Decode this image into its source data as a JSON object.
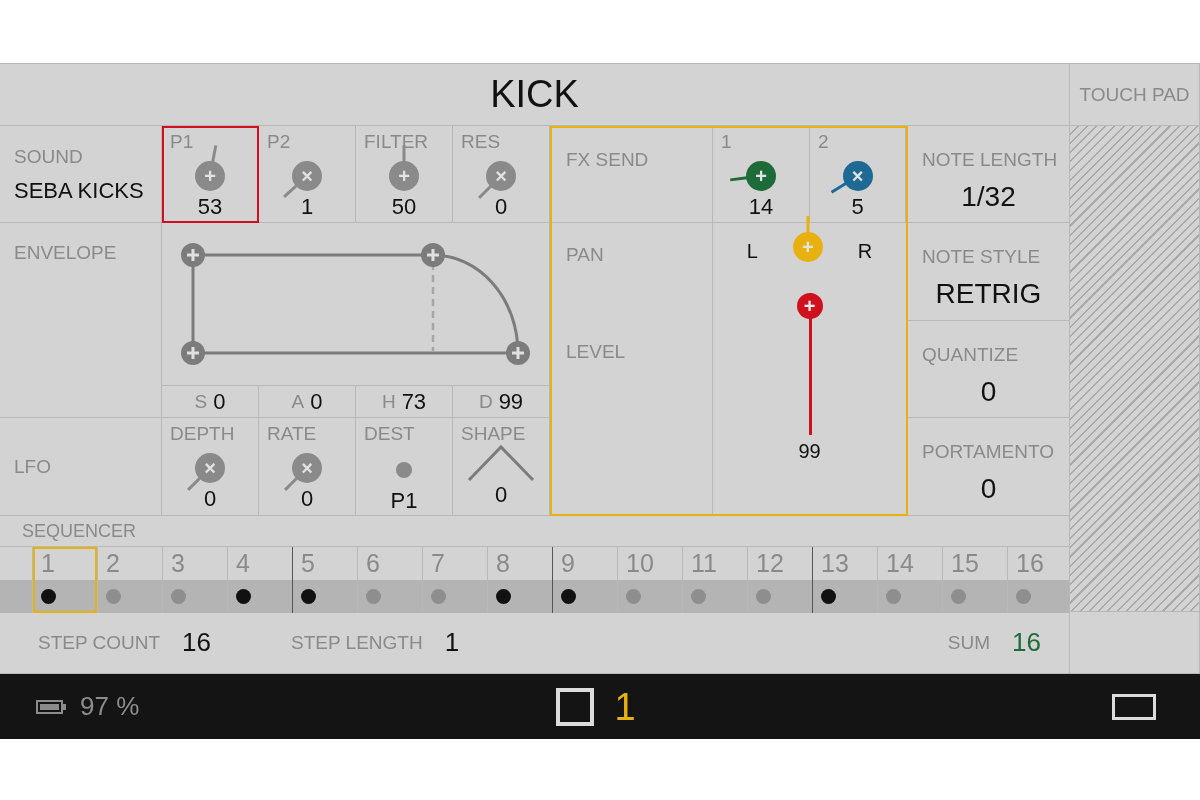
{
  "title": "KICK",
  "touch_pad": {
    "label": "TOUCH PAD"
  },
  "sound": {
    "label": "SOUND",
    "value": "SEBA KICKS"
  },
  "params": [
    {
      "label": "P1",
      "symbol": "+",
      "value": "53",
      "level": 0.54,
      "selected": true
    },
    {
      "label": "P2",
      "symbol": "×",
      "value": "1",
      "level": 0.01,
      "selected": false
    },
    {
      "label": "FILTER",
      "symbol": "+",
      "value": "50",
      "level": 0.5,
      "selected": false
    },
    {
      "label": "RES",
      "symbol": "×",
      "value": "0",
      "level": 0,
      "selected": false
    }
  ],
  "envelope": {
    "label": "ENVELOPE",
    "stages": [
      {
        "letter": "S",
        "value": "0"
      },
      {
        "letter": "A",
        "value": "0"
      },
      {
        "letter": "H",
        "value": "73"
      },
      {
        "letter": "D",
        "value": "99"
      }
    ]
  },
  "lfo": {
    "label": "LFO",
    "params": [
      {
        "kind": "knob",
        "label": "DEPTH",
        "symbol": "×",
        "value": "0",
        "level": 0
      },
      {
        "kind": "knob",
        "label": "RATE",
        "symbol": "×",
        "value": "0",
        "level": 0
      },
      {
        "kind": "dest",
        "label": "DEST",
        "value": "P1"
      },
      {
        "kind": "shape",
        "label": "SHAPE",
        "value": "0"
      }
    ]
  },
  "fx": {
    "send_label": "FX SEND",
    "sends": [
      {
        "label": "1",
        "symbol": "+",
        "value": "14",
        "level": 0.14,
        "color": "#1e6b3a"
      },
      {
        "label": "2",
        "symbol": "×",
        "value": "5",
        "level": 0.05,
        "color": "#1f6a94"
      }
    ],
    "pan": {
      "label": "PAN",
      "left": "L",
      "right": "R",
      "symbol": "+",
      "level": 0.5
    },
    "level": {
      "label": "LEVEL",
      "symbol": "+",
      "value": "99",
      "level": 1
    }
  },
  "note": [
    {
      "label": "NOTE LENGTH",
      "value": "1/32"
    },
    {
      "label": "NOTE STYLE",
      "value": "RETRIG"
    },
    {
      "label": "QUANTIZE",
      "value": "0"
    },
    {
      "label": "PORTAMENTO",
      "value": "0"
    }
  ],
  "sequencer": {
    "label": "SEQUENCER",
    "steps": [
      {
        "number": "1",
        "on": true,
        "selected": true
      },
      {
        "number": "2",
        "on": false,
        "selected": false
      },
      {
        "number": "3",
        "on": false,
        "selected": false
      },
      {
        "number": "4",
        "on": true,
        "selected": false
      },
      {
        "number": "5",
        "on": true,
        "selected": false
      },
      {
        "number": "6",
        "on": false,
        "selected": false
      },
      {
        "number": "7",
        "on": false,
        "selected": false
      },
      {
        "number": "8",
        "on": true,
        "selected": false
      },
      {
        "number": "9",
        "on": true,
        "selected": false
      },
      {
        "number": "10",
        "on": false,
        "selected": false
      },
      {
        "number": "11",
        "on": false,
        "selected": false
      },
      {
        "number": "12",
        "on": false,
        "selected": false
      },
      {
        "number": "13",
        "on": true,
        "selected": false
      },
      {
        "number": "14",
        "on": false,
        "selected": false
      },
      {
        "number": "15",
        "on": false,
        "selected": false
      },
      {
        "number": "16",
        "on": false,
        "selected": false
      }
    ]
  },
  "footer": {
    "step_count": {
      "label": "STEP COUNT",
      "value": "16"
    },
    "step_length": {
      "label": "STEP LENGTH",
      "value": "1"
    },
    "sum": {
      "label": "SUM",
      "value": "16"
    }
  },
  "status_bar": {
    "battery": "97 %",
    "pattern": "1"
  }
}
